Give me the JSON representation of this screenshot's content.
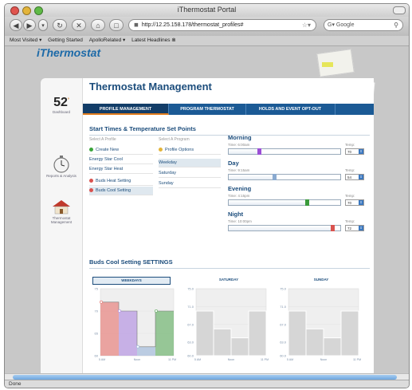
{
  "browser": {
    "window_title": "iThermostat Portal",
    "url": "http://12.25.158.178/thermostat_profiles#",
    "search_placeholder": "Google",
    "bookmarks": [
      "Most Visited ▾",
      "Getting Started",
      "ApolloRelated ▾",
      "Latest Headlines ⋒"
    ],
    "status": "Done"
  },
  "app": {
    "logo": "iThermostat",
    "page_title": "Thermostat Management",
    "tabs": [
      "PROFILE MANAGEMENT",
      "PROGRAM THERMOSTAT",
      "HOLDS AND EVENT OPT-OUT"
    ],
    "active_tab": 0
  },
  "leftnav": {
    "current_temp": "52",
    "temp_unit": "°",
    "dashboard_label": "Dashboard",
    "reports_label": "Reports & Analysis",
    "thermostat_label": "Thermostat Management"
  },
  "section": {
    "title": "Start Times & Temperature Set Points",
    "select_profile_label": "Select A Profile",
    "select_program_label": "Select A Program"
  },
  "profiles": [
    {
      "label": "Create New",
      "icon": "plus-icon",
      "color": "#3aa53a"
    },
    {
      "label": "Energy Star Cool",
      "icon": "",
      "color": ""
    },
    {
      "label": "Energy Star Heat",
      "icon": "",
      "color": ""
    },
    {
      "label": "Buds Heat Setting",
      "icon": "dot-icon",
      "color": "#d9534f"
    },
    {
      "label": "Buds Cool Setting",
      "icon": "dot-icon",
      "color": "#d9534f"
    }
  ],
  "selected_profile": 4,
  "programs": [
    {
      "label": "Profile Options",
      "icon": "gear-icon"
    },
    {
      "label": "Weekday",
      "icon": ""
    },
    {
      "label": "Saturday",
      "icon": ""
    },
    {
      "label": "Sunday",
      "icon": ""
    }
  ],
  "selected_program": 1,
  "periods": [
    {
      "name": "Morning",
      "time": "Time: 6:00am",
      "temp_label": "Temp:",
      "temp": "70",
      "color": "#9b4fd6",
      "position": 0.27
    },
    {
      "name": "Day",
      "time": "Time: 9:15am",
      "temp_label": "Temp:",
      "temp": "54",
      "color": "#8aaad0",
      "position": 0.41
    },
    {
      "name": "Evening",
      "time": "Time: 4:15pm",
      "temp_label": "Temp:",
      "temp": "70",
      "color": "#3a9a3a",
      "position": 0.7
    },
    {
      "name": "Night",
      "time": "Time: 10:00pm",
      "temp_label": "Temp:",
      "temp": "72",
      "color": "#d9534f",
      "position": 0.93
    }
  ],
  "settings_title": "Buds Cool Setting SETTINGS",
  "chart_data": [
    {
      "type": "area",
      "title": "WEEKDAYS",
      "x_labels": [
        "5 AM",
        "Noon",
        "11 PM"
      ],
      "ylim": [
        60,
        75
      ],
      "y_ticks": [
        "75",
        "70",
        "65",
        "60"
      ],
      "segments": [
        {
          "color": "#e88a86",
          "value": 72
        },
        {
          "color": "#b99be3",
          "value": 70
        },
        {
          "color": "#a9c0de",
          "value": 62
        },
        {
          "color": "#78b878",
          "value": 70
        }
      ]
    },
    {
      "type": "area",
      "title": "SATURDAY",
      "x_labels": [
        "5 AM",
        "Noon",
        "11 PM"
      ],
      "ylim": [
        60,
        75
      ],
      "y_ticks": [
        "75.0",
        "71.0",
        "67.0",
        "63.0",
        "60.0"
      ],
      "segments": [
        {
          "color": "#d6d6d6",
          "value": 70
        },
        {
          "color": "#d6d6d6",
          "value": 66
        },
        {
          "color": "#d6d6d6",
          "value": 64
        },
        {
          "color": "#d6d6d6",
          "value": 70
        }
      ]
    },
    {
      "type": "area",
      "title": "SUNDAY",
      "x_labels": [
        "5 AM",
        "Noon",
        "11 PM"
      ],
      "ylim": [
        60,
        75
      ],
      "y_ticks": [
        "75.0",
        "71.0",
        "67.0",
        "63.0",
        "60.0"
      ],
      "segments": [
        {
          "color": "#d6d6d6",
          "value": 70
        },
        {
          "color": "#d6d6d6",
          "value": 66
        },
        {
          "color": "#d6d6d6",
          "value": 64
        },
        {
          "color": "#d6d6d6",
          "value": 70
        }
      ]
    }
  ]
}
